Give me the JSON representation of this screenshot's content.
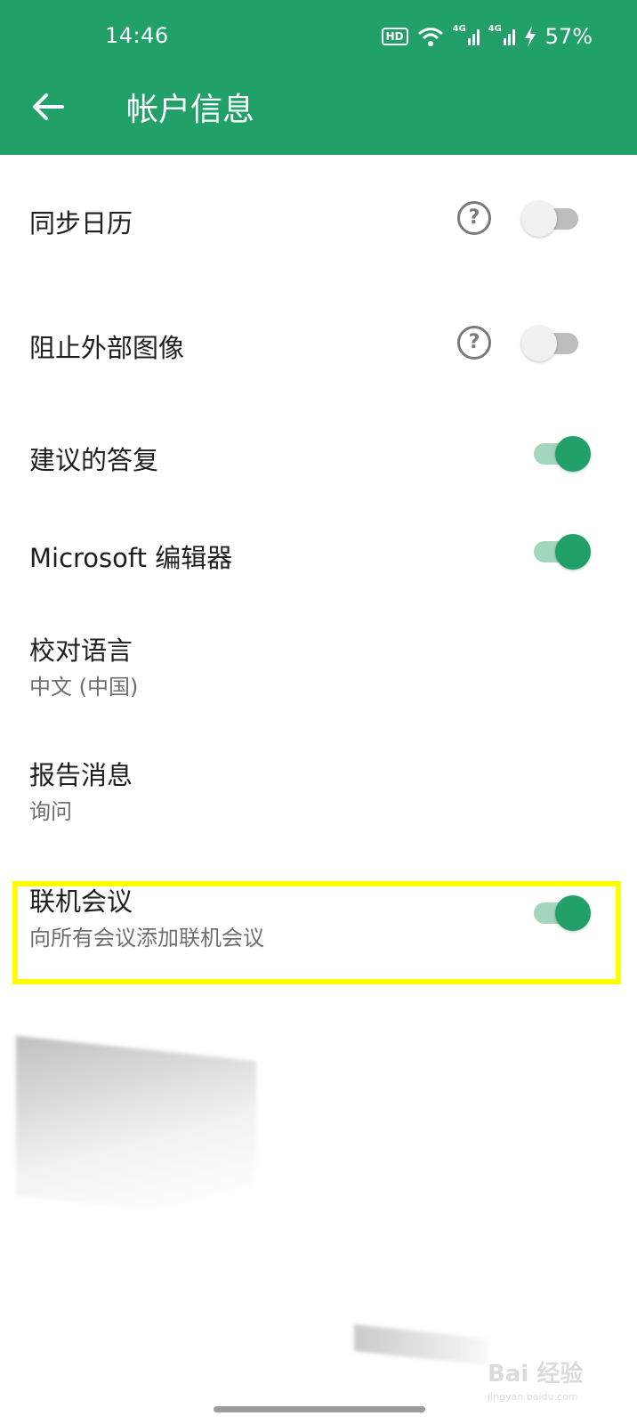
{
  "status_bar": {
    "time": "14:46",
    "hd_badge": "HD",
    "network_1": "4G",
    "network_2": "4G",
    "battery_percent": "57%",
    "icons": [
      "hd-voice-icon",
      "wifi-icon",
      "signal-icon",
      "signal-icon",
      "charging-icon"
    ]
  },
  "app_bar": {
    "title": "帐户信息",
    "back_icon": "arrow-left-icon",
    "background_color": "#21a06a"
  },
  "settings": [
    {
      "label": "同步日历",
      "has_help": true,
      "toggle": false
    },
    {
      "label": "阻止外部图像",
      "has_help": true,
      "toggle": false
    },
    {
      "label": "建议的答复",
      "has_help": false,
      "toggle": true
    },
    {
      "label": "Microsoft 编辑器",
      "has_help": false,
      "toggle": true
    },
    {
      "label": "校对语言",
      "subtitle": "中文 (中国)"
    },
    {
      "label": "报告消息",
      "subtitle": "询问"
    },
    {
      "label": "联机会议",
      "subtitle": "向所有会议添加联机会议",
      "toggle": true,
      "highlighted": true
    }
  ],
  "colors": {
    "accent": "#21a06a",
    "toggle_on_track": "#a3d6bd",
    "toggle_off_track": "#bdbdbd",
    "highlight": "#ffff00"
  },
  "watermark": {
    "logo": "Bai 经验",
    "url": "jingyan.baidu.com"
  }
}
